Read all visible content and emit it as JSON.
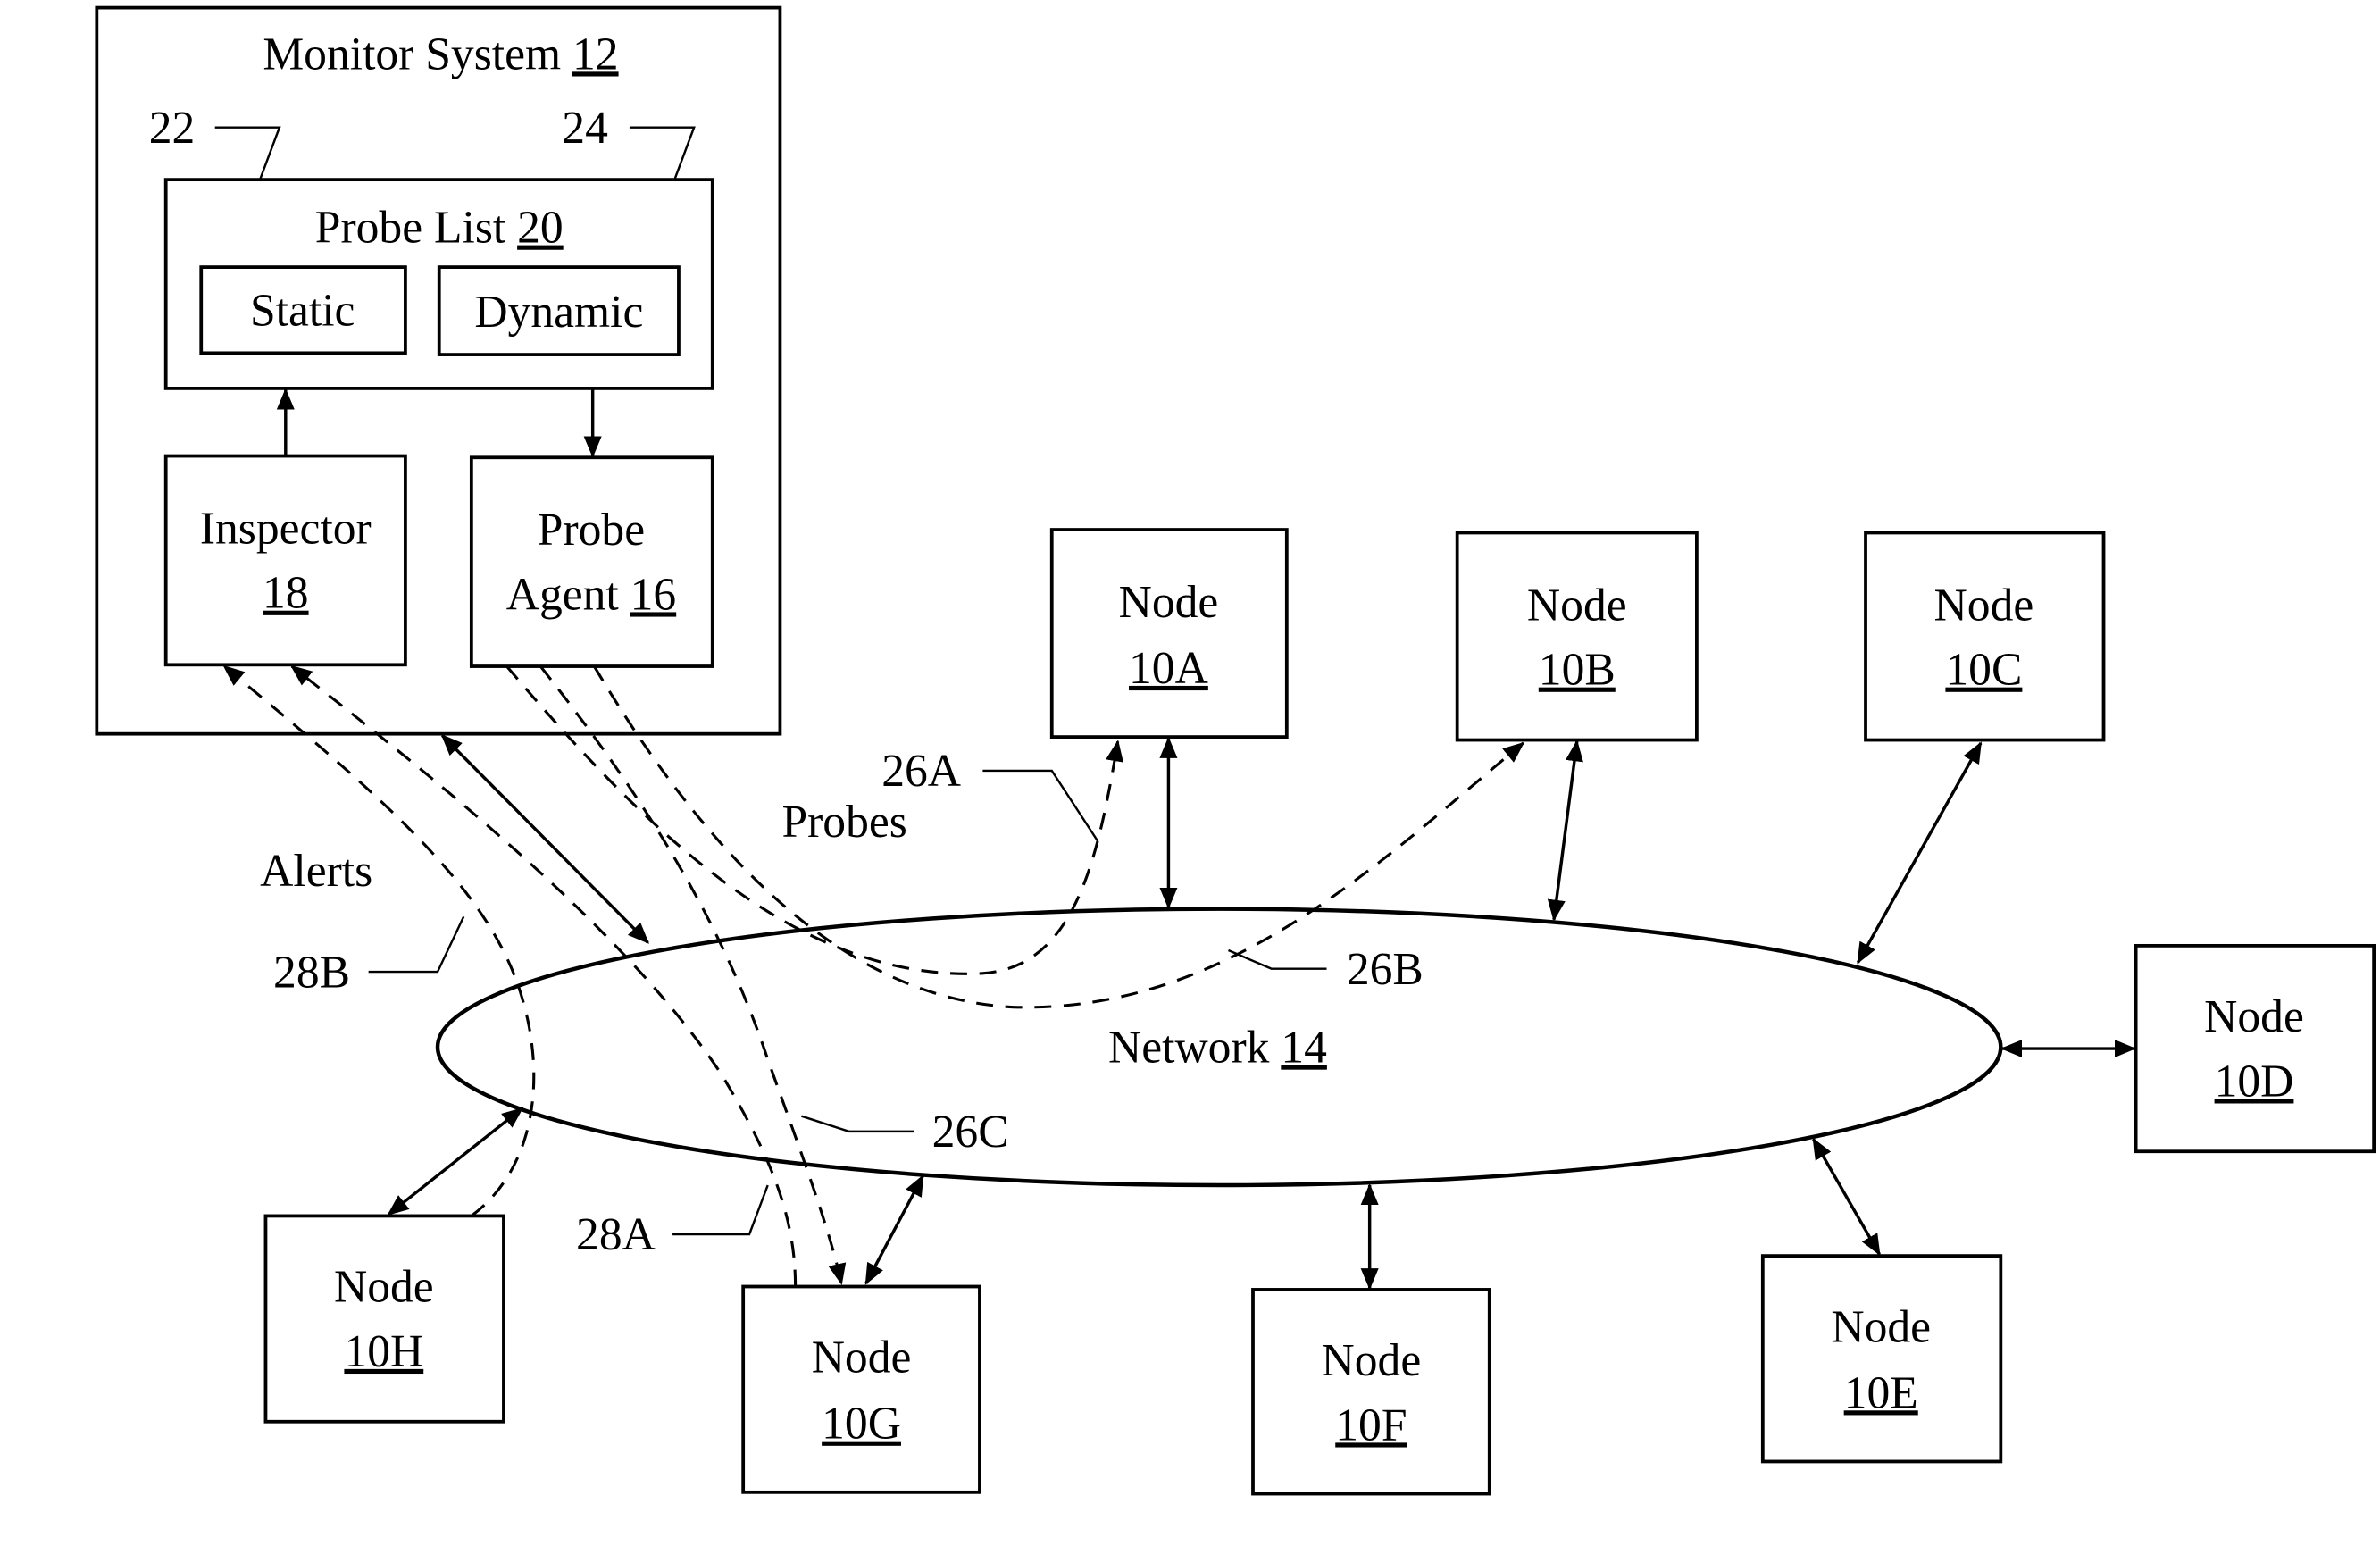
{
  "monitor_system": {
    "title": "Monitor System",
    "ref": "12",
    "probe_list": {
      "title": "Probe List",
      "ref": "20",
      "static": {
        "label": "Static",
        "callout": "22"
      },
      "dynamic": {
        "label": "Dynamic",
        "callout": "24"
      }
    },
    "inspector": {
      "label": "Inspector",
      "ref": "18"
    },
    "probe_agent": {
      "label_line1": "Probe",
      "label_line2": "Agent",
      "ref": "16"
    }
  },
  "network": {
    "label": "Network",
    "ref": "14"
  },
  "nodes": [
    {
      "label": "Node",
      "ref": "10A"
    },
    {
      "label": "Node",
      "ref": "10B"
    },
    {
      "label": "Node",
      "ref": "10C"
    },
    {
      "label": "Node",
      "ref": "10D"
    },
    {
      "label": "Node",
      "ref": "10E"
    },
    {
      "label": "Node",
      "ref": "10F"
    },
    {
      "label": "Node",
      "ref": "10G"
    },
    {
      "label": "Node",
      "ref": "10H"
    }
  ],
  "flows": {
    "alerts_label": "Alerts",
    "probes_label": "Probes",
    "callouts": {
      "probe_to_10A": "26A",
      "probe_to_10B": "26B",
      "probe_to_10G": "26C",
      "alert_from_10G": "28A",
      "alert_from_10H": "28B"
    }
  }
}
